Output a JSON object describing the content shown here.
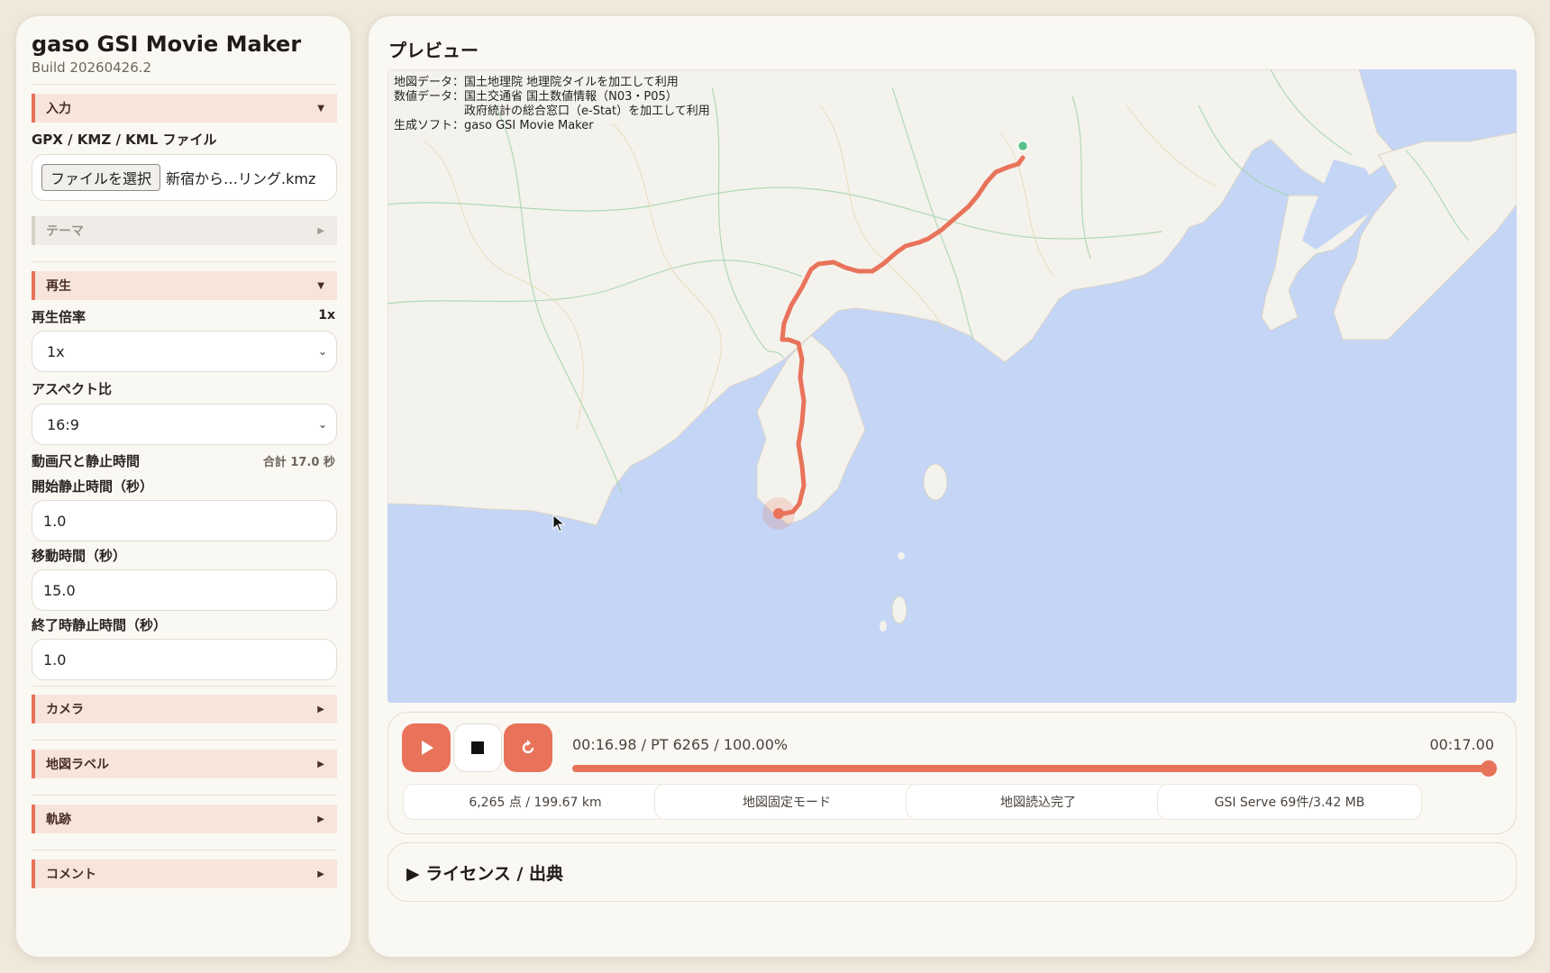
{
  "app": {
    "title": "gaso GSI Movie Maker",
    "build": "Build 20260426.2"
  },
  "sections": {
    "input": "入力",
    "theme": "テーマ",
    "playback": "再生",
    "camera": "カメラ",
    "map_label": "地図ラベル",
    "track": "軌跡",
    "comment": "コメント"
  },
  "input": {
    "file_label": "GPX / KMZ / KML ファイル",
    "file_button": "ファイルを選択",
    "file_name": "新宿から…リング.kmz"
  },
  "playback": {
    "speed_label": "再生倍率",
    "speed_value": "1x",
    "speed_select": "1x",
    "aspect_label": "アスペクト比",
    "aspect_select": "16:9",
    "duration_label": "動画尺と静止時間",
    "total": "合計 17.0 秒",
    "start_hold_label": "開始静止時間（秒）",
    "start_hold": "1.0",
    "move_label": "移動時間（秒）",
    "move": "15.0",
    "end_hold_label": "終了時静止時間（秒）",
    "end_hold": "1.0"
  },
  "preview": {
    "title": "プレビュー",
    "attribution": "地図データ：国土地理院 地理院タイルを加工して利用\n数値データ：国土交通省 国土数値情報（N03・P05）\n　　　　　　政府統計の総合窓口（e-Stat）を加工して利用\n生成ソフト：gaso GSI Movie Maker",
    "progress": 1.0
  },
  "controls": {
    "status": "00:16.98 / PT 6265 / 100.00%",
    "duration": "00:17.00",
    "stats": [
      "6,265 点 / 199.67 km",
      "地図固定モード",
      "地図読込完了",
      "GSI Serve 69件/3.42 MB"
    ]
  },
  "license": {
    "label": "▶ ライセンス / 出典"
  },
  "colors": {
    "accent": "#e8735a",
    "sea": "#c4d5f6",
    "land": "#f4f2ec",
    "start": "#5bc08a"
  }
}
